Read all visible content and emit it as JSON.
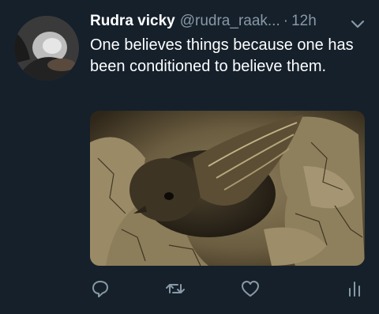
{
  "tweet": {
    "author_name": "Rudra vicky",
    "handle": "@rudra_raak...",
    "separator": "·",
    "time": "12h",
    "text": "One believes things because one has been conditioned to believe them."
  },
  "icons": {
    "menu": "chevron-down-icon",
    "reply": "reply-icon",
    "retweet": "retweet-icon",
    "like": "heart-icon",
    "analytics": "analytics-icon"
  },
  "colors": {
    "background": "#15202b",
    "primary_text": "#ffffff",
    "secondary_text": "#8899a6"
  }
}
